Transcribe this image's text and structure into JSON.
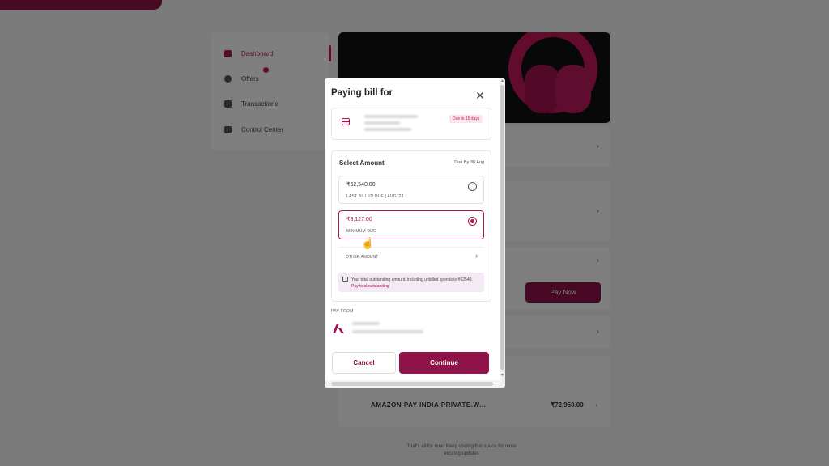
{
  "background": {
    "sidebar": {
      "items": [
        {
          "label": "Dashboard",
          "icon": "dashboard-icon",
          "active": true
        },
        {
          "label": "Offers",
          "icon": "offers-icon",
          "active": false
        },
        {
          "label": "Transactions",
          "icon": "transactions-icon",
          "active": false
        },
        {
          "label": "Control Center",
          "icon": "control-center-icon",
          "active": false
        }
      ]
    },
    "pay_now_label": "Pay Now",
    "recent_transaction": {
      "merchant": "AMAZON PAY INDIA PRIVATE.W...",
      "amount": "₹72,950.00"
    },
    "footer_note": "That's all for now! Keep visiting this space for more exciting updates"
  },
  "modal": {
    "title": "Paying bill for",
    "card": {
      "due_badge": "Due in 15 days"
    },
    "select_amount": {
      "title": "Select Amount",
      "due_by": "Due By 30 Aug",
      "options": [
        {
          "amount": "₹62,540.00",
          "label": "LAST BILLED DUE | AUG '23",
          "selected": false
        },
        {
          "amount": "₹3,127.00",
          "label": "MINIMUM DUE",
          "selected": true
        }
      ],
      "other_amount_label": "OTHER AMOUNT",
      "info_text": "Your total outstanding amount, including unbilled spends is ₹62540.",
      "info_link": "Pay total outstanding"
    },
    "pay_from_label": "PAY FROM",
    "cancel_label": "Cancel",
    "continue_label": "Continue"
  },
  "colors": {
    "brand": "#8f1248",
    "accent": "#b0154f",
    "info_bg": "#f3eaf4"
  }
}
